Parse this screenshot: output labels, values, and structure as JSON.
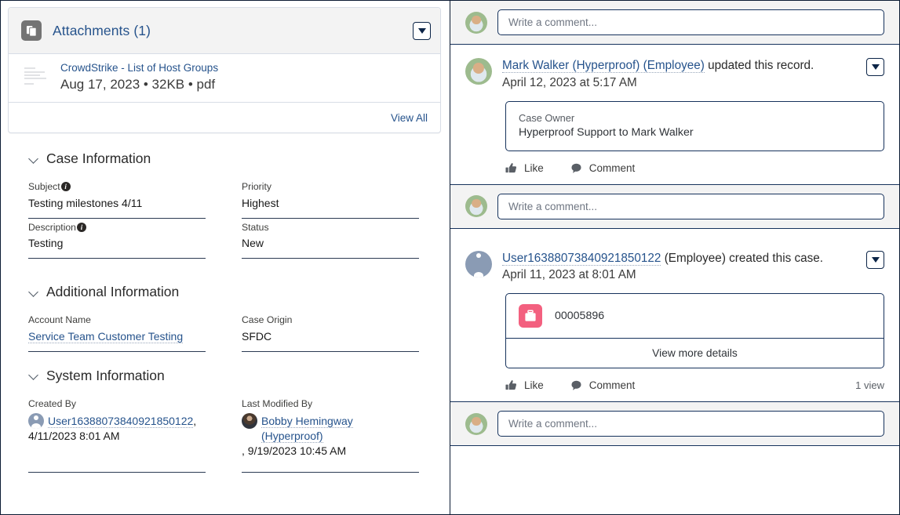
{
  "attachments": {
    "icon": "document-copy-icon",
    "title": "Attachments (1)",
    "menu_icon": "chevron-down-icon",
    "items": [
      {
        "name": "CrowdStrike - List of Host Groups",
        "meta": "Aug 17, 2023 • 32KB • pdf"
      }
    ],
    "view_all_label": "View All"
  },
  "case_information": {
    "title": "Case Information",
    "fields": [
      {
        "label": "Subject",
        "has_info": true,
        "value": "Testing milestones 4/11"
      },
      {
        "label": "Priority",
        "has_info": false,
        "value": "Highest"
      },
      {
        "label": "Description",
        "has_info": true,
        "value": "Testing"
      },
      {
        "label": "Status",
        "has_info": false,
        "value": "New"
      }
    ]
  },
  "additional_information": {
    "title": "Additional Information",
    "fields": [
      {
        "label": "Account Name",
        "value": "Service Team Customer Testing",
        "is_link": true
      },
      {
        "label": "Case Origin",
        "value": "SFDC",
        "is_link": false
      }
    ]
  },
  "system_information": {
    "title": "System Information",
    "created_by": {
      "label": "Created By",
      "user": "User16388073840921850122",
      "separator": ",",
      "timestamp": "4/11/2023 8:01 AM"
    },
    "last_modified_by": {
      "label": "Last Modified By",
      "user_line1": "Bobby Hemingway",
      "user_line2": "(Hyperproof)",
      "timestamp": ", 9/19/2023 10:45 AM"
    }
  },
  "feed": {
    "comment_placeholder": "Write a comment...",
    "like_label": "Like",
    "comment_label": "Comment",
    "items": [
      {
        "actor": "Mark Walker (Hyperproof) (Employee)",
        "action": " updated this record.",
        "timestamp": "April 12, 2023 at 5:17 AM",
        "record_label": "Case Owner",
        "record_value": "Hyperproof Support to Mark Walker",
        "views": ""
      },
      {
        "actor": "User16388073840921850122",
        "action": " (Employee) created this case.",
        "timestamp": "April 11, 2023 at 8:01 AM",
        "case_number": "00005896",
        "view_more_label": "View more details",
        "views": "1 view"
      }
    ]
  },
  "colors": {
    "link": "#26538c",
    "border_dark": "#16325c",
    "case_icon_pink": "#f3607f",
    "panel_gray": "#f3f3f3"
  }
}
